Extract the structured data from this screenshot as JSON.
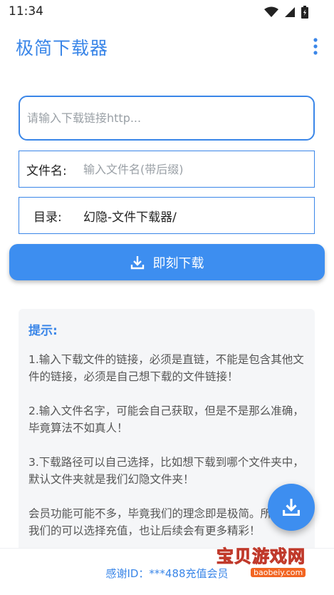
{
  "status_bar": {
    "time": "11:34"
  },
  "app_bar": {
    "title": "极简下载器"
  },
  "form": {
    "url_placeholder": "请输入下载链接http...",
    "filename_label": "文件名:",
    "filename_placeholder": "输入文件名(带后缀)",
    "dir_label": "目录:",
    "dir_value": "幻隐-文件下载器/"
  },
  "download_button": {
    "label": "即刻下载"
  },
  "tips": {
    "title": "提示:",
    "items": [
      "1.输入下载文件的链接，必须是直链，不能是包含其他文件的链接，必须是自己想下载的文件链接！",
      "2.输入文件名字，可能会自己获取，但是不是那么准确，毕竟算法不如真人！",
      "3.下载路径可以自己选择，比如想下载到哪个文件夹中，默认文件夹就是我们幻隐文件夹！",
      "会员功能可能不多，毕竟我们的理念即是极简。所以支持我们的可以选择充值，也让后续会有更多精彩！"
    ]
  },
  "bottom": {
    "thanks": "感谢ID：***488充值会员"
  },
  "watermark": {
    "main": "宝贝游戏网",
    "sub": "baobeiy.com"
  },
  "colors": {
    "accent": "#3a86e8",
    "button": "#3d8ef0"
  }
}
